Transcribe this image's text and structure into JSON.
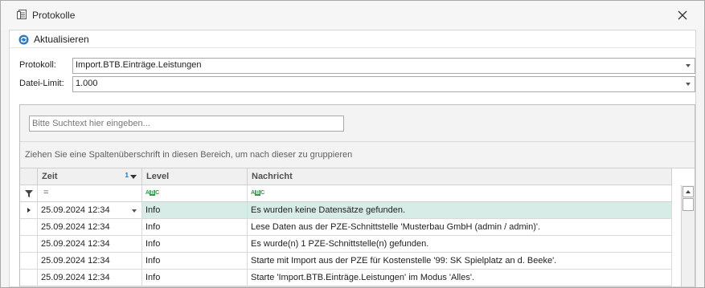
{
  "window": {
    "title": "Protokolle"
  },
  "toolbar": {
    "refresh_label": "Aktualisieren"
  },
  "form": {
    "protokoll_label": "Protokoll:",
    "protokoll_value": "Import.BTB.Einträge.Leistungen",
    "limit_label": "Datei-Limit:",
    "limit_value": "1.000"
  },
  "search": {
    "placeholder": "Bitte Suchtext hier eingeben..."
  },
  "group_hint": "Ziehen Sie eine Spaltenüberschrift in diesen Bereich, um nach dieser zu gruppieren",
  "grid": {
    "columns": [
      "Zeit",
      "Level",
      "Nachricht"
    ],
    "sort_index": "1",
    "filter_equals": "=",
    "rows": [
      {
        "zeit": "25.09.2024 12:34",
        "level": "Info",
        "nachricht": "Es wurden keine Datensätze gefunden."
      },
      {
        "zeit": "25.09.2024 12:34",
        "level": "Info",
        "nachricht": "Lese Daten aus der PZE-Schnittstelle 'Musterbau GmbH (admin / admin)'."
      },
      {
        "zeit": "25.09.2024 12:34",
        "level": "Info",
        "nachricht": "Es wurde(n) 1 PZE-Schnittstelle(n) gefunden."
      },
      {
        "zeit": "25.09.2024 12:34",
        "level": "Info",
        "nachricht": "Starte mit Import aus der PZE für Kostenstelle '99: SK Spielplatz an d. Beeke'."
      },
      {
        "zeit": "25.09.2024 12:34",
        "level": "Info",
        "nachricht": "Starte 'Import.BTB.Einträge.Leistungen' im Modus 'Alles'."
      }
    ]
  },
  "colors": {
    "selected_row": "#d7ece6",
    "accent": "#1f6fb2"
  }
}
